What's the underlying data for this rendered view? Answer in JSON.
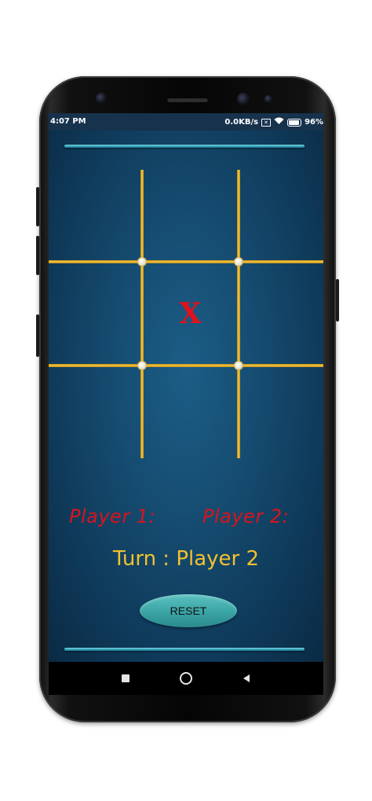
{
  "status_bar": {
    "time": "4:07 PM",
    "net_speed": "0.0KB/s",
    "battery_pct": "96%",
    "icons": [
      "box-x-icon",
      "wifi-icon",
      "battery-icon"
    ]
  },
  "board": {
    "cells": [
      "",
      "",
      "",
      "",
      "X",
      "",
      "",
      "",
      ""
    ]
  },
  "players": {
    "player1_label": "Player 1:",
    "player2_label": "Player 2:"
  },
  "turn": {
    "text": "Turn : Player 2"
  },
  "reset": {
    "label": "RESET"
  },
  "navigation": {
    "icons": [
      "square-icon",
      "circle-icon",
      "triangle-back-icon"
    ]
  },
  "colors": {
    "background": "#164d72",
    "sticks": "#f5c73c",
    "mark_x": "#e0121b",
    "player_labels": "#d8141c",
    "turn_text": "#f2c12e",
    "reset_button": "#3aa4a4"
  }
}
